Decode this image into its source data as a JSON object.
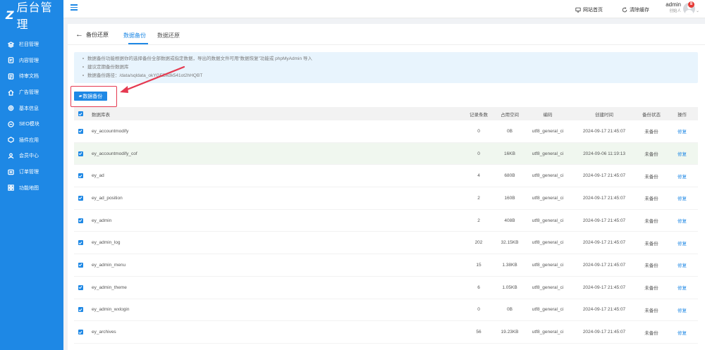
{
  "sidebar": {
    "logo_text": "后台管理",
    "items": [
      {
        "label": "栏目管理",
        "icon": "layers-icon"
      },
      {
        "label": "内容管理",
        "icon": "document-icon"
      },
      {
        "label": "待审文档",
        "icon": "checklist-icon"
      },
      {
        "label": "广告管理",
        "icon": "home-icon"
      },
      {
        "label": "基本信息",
        "icon": "settings-icon"
      },
      {
        "label": "SEO模块",
        "icon": "seo-icon"
      },
      {
        "label": "插件应用",
        "icon": "plugin-icon"
      },
      {
        "label": "会员中心",
        "icon": "user-icon"
      },
      {
        "label": "订单管理",
        "icon": "order-icon"
      },
      {
        "label": "功能地图",
        "icon": "grid-icon"
      }
    ]
  },
  "header": {
    "site_home": "网站首页",
    "clear_cache": "清除缓存",
    "user_name": "admin",
    "user_role": "创始人",
    "badge_count": "8"
  },
  "page": {
    "back_label": "备份还原",
    "tabs": [
      {
        "label": "数据备份",
        "active": true
      },
      {
        "label": "数据还原",
        "active": false
      }
    ],
    "notice": [
      "数据备份功能根据你的选择备份全部数据或指定数据，导出的数据文件可用“数据恢复”功能或 phpMyAdmin 导入",
      "建议定期备份数据库",
      "数据备份路径：/data/sqldata_okYGEDkdk541ot2hHQBT"
    ],
    "backup_button": "数据备份"
  },
  "table": {
    "headers": {
      "name": "数据库表",
      "records": "记录条数",
      "size": "占用空间",
      "encoding": "编码",
      "created": "创建时间",
      "status": "备份状态",
      "action": "操作"
    },
    "rows": [
      {
        "name": "ey_accountmodify",
        "records": "0",
        "size": "0B",
        "encoding": "utf8_general_ci",
        "created": "2024-09-17 21:45:07",
        "status": "未备份",
        "action": "修复"
      },
      {
        "name": "ey_accountmodify_cof",
        "records": "0",
        "size": "16KB",
        "encoding": "utf8_general_ci",
        "created": "2024-09-06 11:19:13",
        "status": "未备份",
        "action": "修复"
      },
      {
        "name": "ey_ad",
        "records": "4",
        "size": "680B",
        "encoding": "utf8_general_ci",
        "created": "2024-09-17 21:45:07",
        "status": "未备份",
        "action": "修复"
      },
      {
        "name": "ey_ad_position",
        "records": "2",
        "size": "160B",
        "encoding": "utf8_general_ci",
        "created": "2024-09-17 21:45:07",
        "status": "未备份",
        "action": "修复"
      },
      {
        "name": "ey_admin",
        "records": "2",
        "size": "408B",
        "encoding": "utf8_general_ci",
        "created": "2024-09-17 21:45:07",
        "status": "未备份",
        "action": "修复"
      },
      {
        "name": "ey_admin_log",
        "records": "202",
        "size": "32.15KB",
        "encoding": "utf8_general_ci",
        "created": "2024-09-17 21:45:07",
        "status": "未备份",
        "action": "修复"
      },
      {
        "name": "ey_admin_menu",
        "records": "15",
        "size": "1.38KB",
        "encoding": "utf8_general_ci",
        "created": "2024-09-17 21:45:07",
        "status": "未备份",
        "action": "修复"
      },
      {
        "name": "ey_admin_theme",
        "records": "6",
        "size": "1.05KB",
        "encoding": "utf8_general_ci",
        "created": "2024-09-17 21:45:07",
        "status": "未备份",
        "action": "修复"
      },
      {
        "name": "ey_admin_wxlogin",
        "records": "0",
        "size": "0B",
        "encoding": "utf8_general_ci",
        "created": "2024-09-17 21:45:07",
        "status": "未备份",
        "action": "修复"
      },
      {
        "name": "ey_archives",
        "records": "56",
        "size": "19.23KB",
        "encoding": "utf8_general_ci",
        "created": "2024-09-17 21:45:07",
        "status": "未备份",
        "action": "修复"
      }
    ]
  },
  "colors": {
    "primary": "#1e88e5",
    "annotation": "#e53950",
    "notice_bg": "#e8f4fd",
    "badge": "#e53935"
  }
}
